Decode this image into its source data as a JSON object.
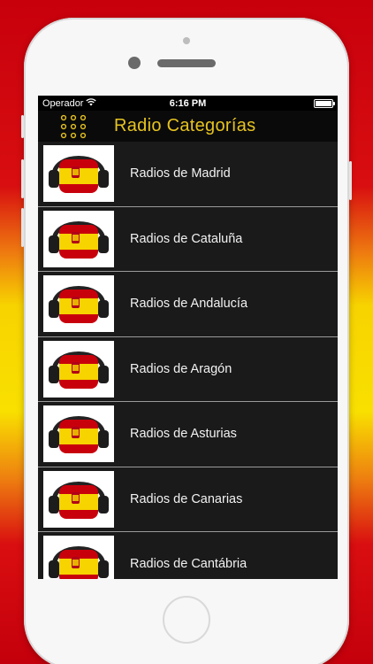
{
  "status_bar": {
    "carrier": "Operador",
    "time": "6:16 PM",
    "wifi_icon": "wifi-icon",
    "battery_icon": "battery-icon"
  },
  "nav": {
    "title": "Radio Categorías",
    "menu_icon": "menu-grid-icon",
    "title_color": "#e6c320"
  },
  "categories": [
    {
      "label": "Radios de Madrid",
      "icon": "spain-flag-headphones-icon"
    },
    {
      "label": "Radios de Cataluña",
      "icon": "spain-flag-headphones-icon"
    },
    {
      "label": "Radios de Andalucía",
      "icon": "spain-flag-headphones-icon"
    },
    {
      "label": "Radios de Aragón",
      "icon": "spain-flag-headphones-icon"
    },
    {
      "label": "Radios de Asturias",
      "icon": "spain-flag-headphones-icon"
    },
    {
      "label": "Radios de Canarias",
      "icon": "spain-flag-headphones-icon"
    },
    {
      "label": "Radios de Cantábria",
      "icon": "spain-flag-headphones-icon"
    }
  ],
  "colors": {
    "flag_red": "#c8000c",
    "flag_yellow": "#f7d300",
    "list_background": "#1a1a1a"
  }
}
